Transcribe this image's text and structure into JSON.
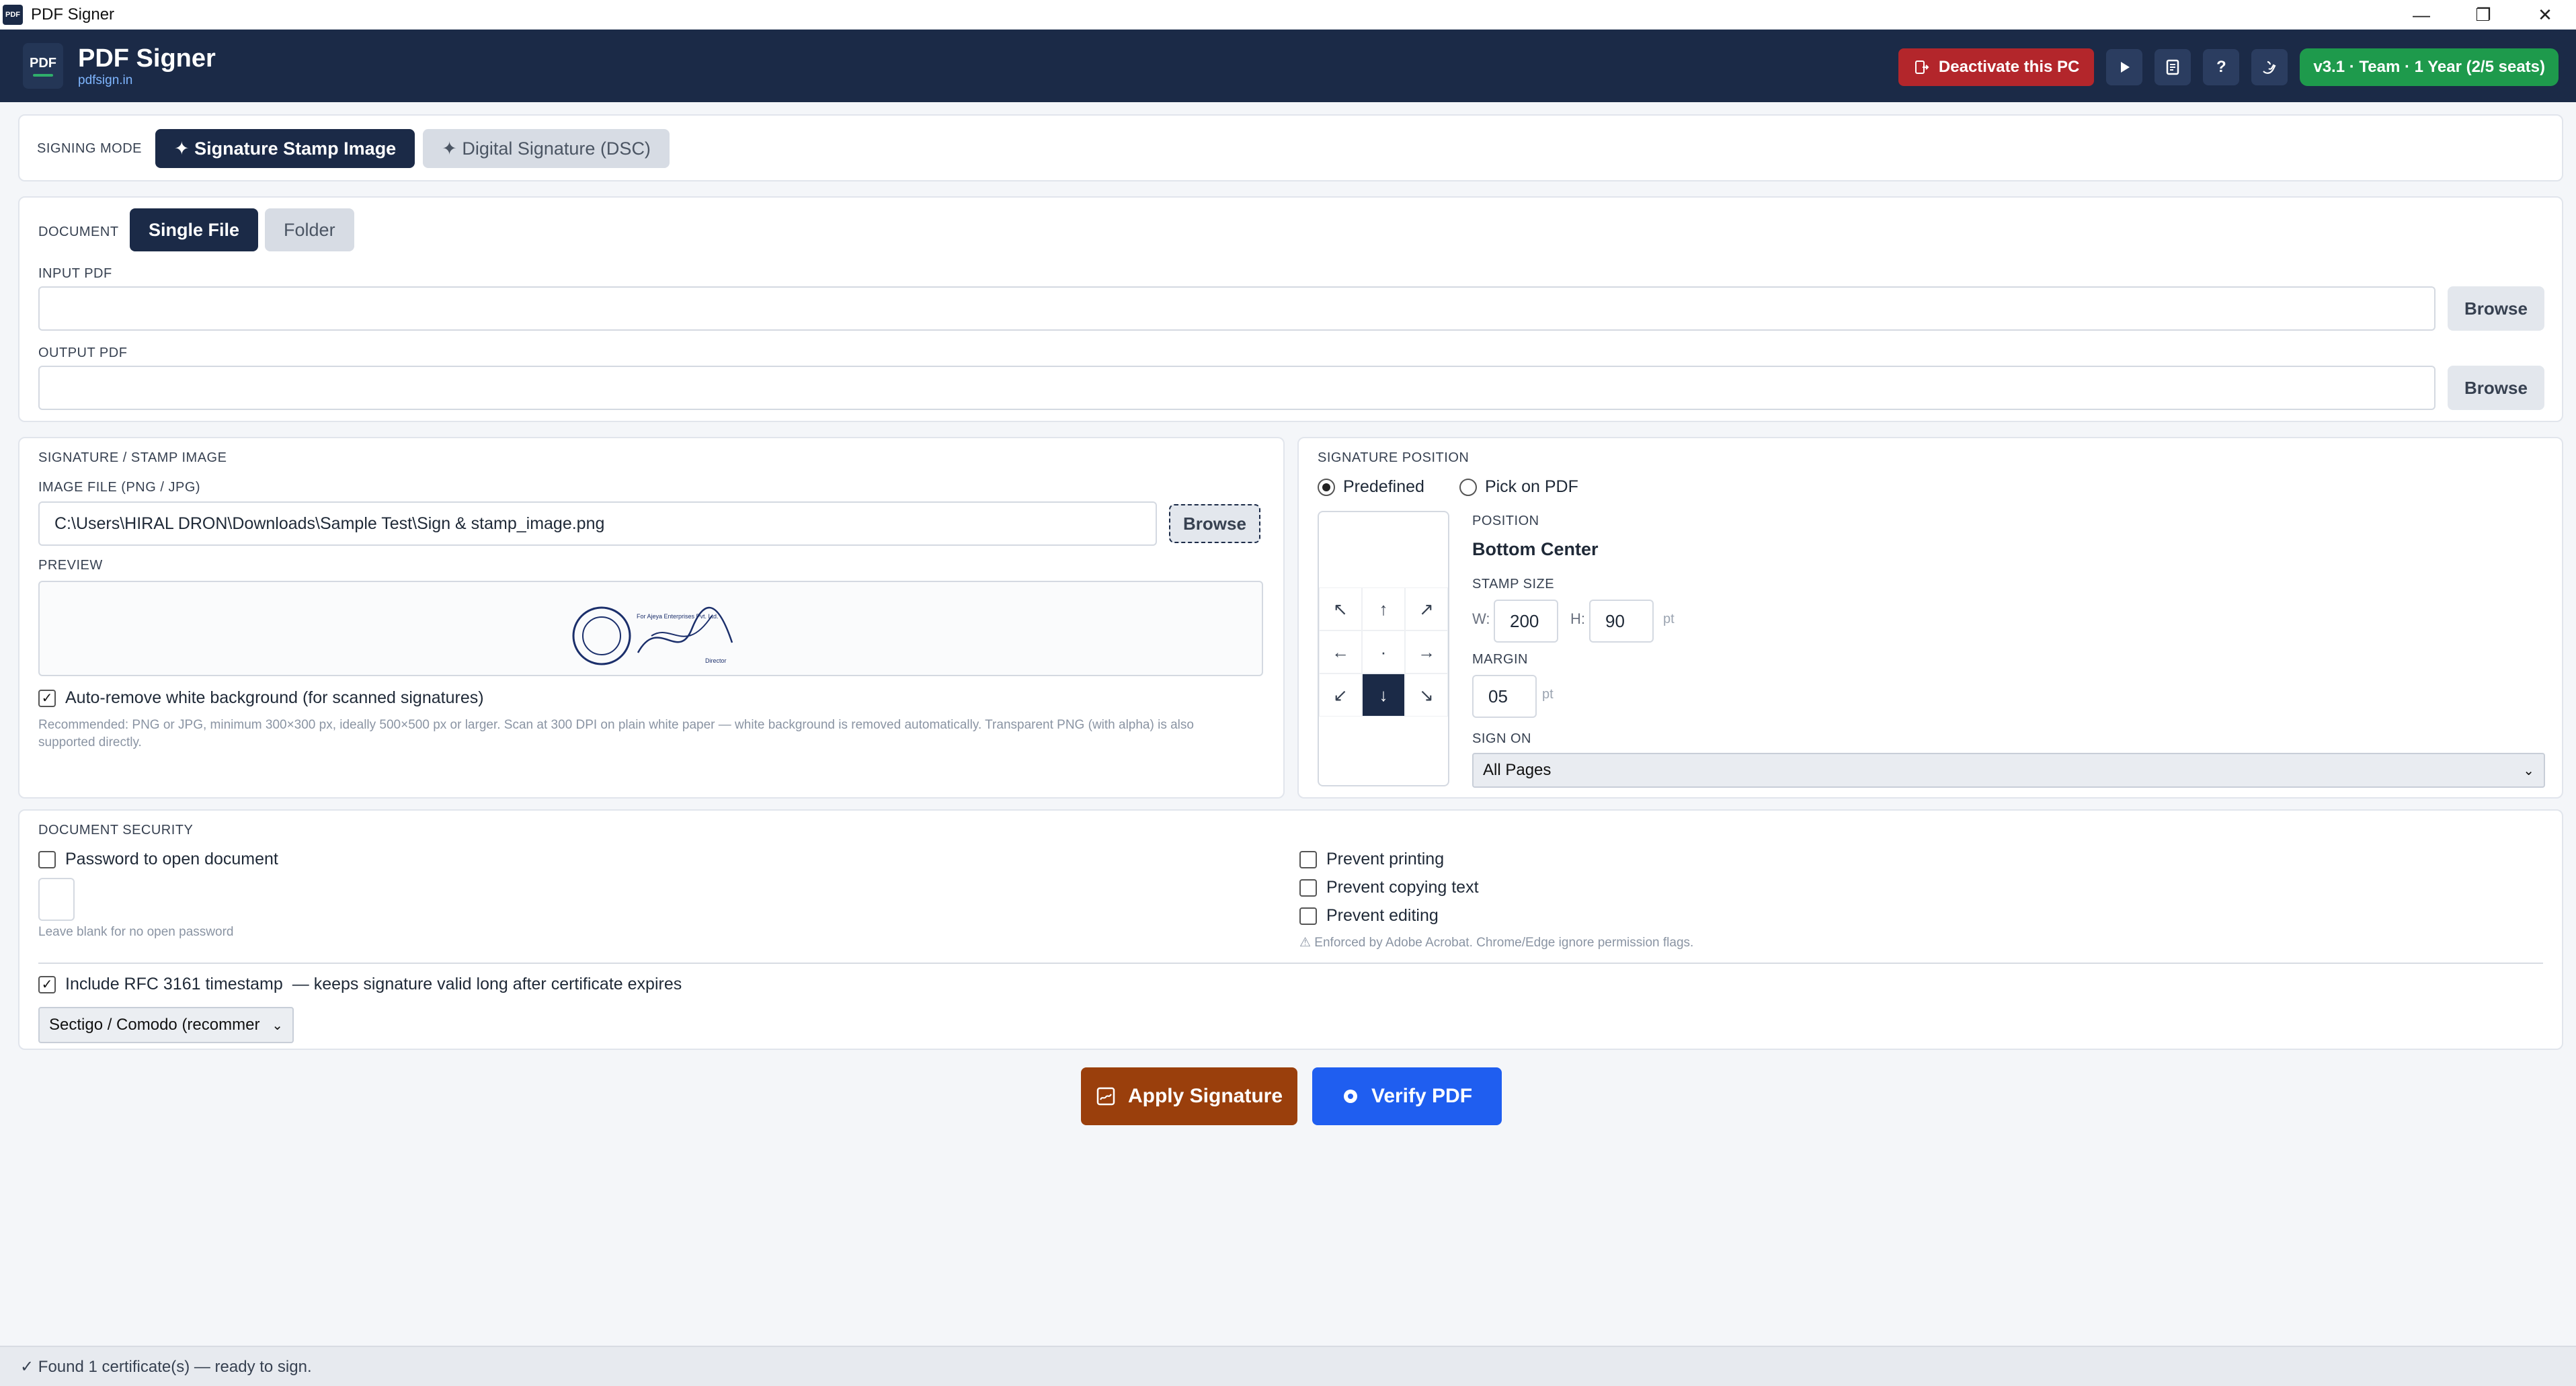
{
  "window": {
    "title": "PDF Signer",
    "app_icon_text": "PDF",
    "controls": {
      "minimize": "—",
      "restore": "❐",
      "close": "✕"
    }
  },
  "header": {
    "logo_text": "PDF",
    "brand_name": "PDF Signer",
    "brand_url": "pdfsign.in",
    "deactivate_label": "Deactivate this PC",
    "icon_buttons": [
      "play-icon",
      "document-icon",
      "help-icon",
      "support-icon"
    ],
    "help_text": "?",
    "license_badge": "v3.1 · Team · 1 Year (2/5 seats)",
    "colors": {
      "header_bg": "#1b2a47",
      "deactivate": "#b3262b",
      "license": "#1e9a4c"
    }
  },
  "signing_mode": {
    "label": "SIGNING MODE",
    "options": [
      "✦ Signature Stamp Image",
      "✦ Digital Signature (DSC)"
    ],
    "selected": "Signature Stamp Image"
  },
  "document": {
    "label": "DOCUMENT",
    "tabs": [
      "Single File",
      "Folder"
    ],
    "selected_tab": "Single File",
    "input_label": "INPUT PDF",
    "input_value": "",
    "output_label": "OUTPUT PDF",
    "output_value": "",
    "browse_label": "Browse"
  },
  "stamp_image": {
    "section_label": "SIGNATURE / STAMP IMAGE",
    "file_label": "IMAGE FILE (PNG / JPG)",
    "file_value": "C:\\Users\\HIRAL DRON\\Downloads\\Sample Test\\Sign & stamp_image.png",
    "browse_label": "Browse",
    "preview_label": "PREVIEW",
    "stamp_text": "For Ajeya Enterprises Pvt. Ltd.",
    "stamp_sub": "Director",
    "auto_remove_label": "Auto-remove white background (for scanned signatures)",
    "auto_remove_checked": true,
    "recommendation": "Recommended: PNG or JPG, minimum 300×300 px, ideally 500×500 px or larger. Scan at 300 DPI on plain white paper — white background is removed automatically. Transparent PNG (with alpha) is also supported directly."
  },
  "position": {
    "section_label": "SIGNATURE POSITION",
    "modes": [
      "Predefined",
      "Pick on PDF"
    ],
    "selected_mode": "Predefined",
    "grid_arrows": [
      "↖",
      "↑",
      "↗",
      "←",
      "·",
      "→",
      "↙",
      "↓",
      "↘"
    ],
    "selected_cell": "Bottom Center",
    "position_label": "POSITION",
    "position_value": "Bottom Center",
    "stamp_size_label": "STAMP SIZE",
    "width_label": "W:",
    "width_value": "200",
    "height_label": "H:",
    "height_value": "90",
    "unit": "pt",
    "margin_label": "MARGIN",
    "margin_value": "05",
    "sign_on_label": "SIGN ON",
    "sign_on_value": "All Pages"
  },
  "security": {
    "section_label": "DOCUMENT SECURITY",
    "password_label": "Password to open document",
    "password_checked": false,
    "password_hint": "Leave blank for no open password",
    "permissions": [
      {
        "label": "Prevent printing",
        "checked": false
      },
      {
        "label": "Prevent copying text",
        "checked": false
      },
      {
        "label": "Prevent editing",
        "checked": false
      }
    ],
    "permissions_note": "⚠ Enforced by Adobe Acrobat. Chrome/Edge ignore permission flags.",
    "timestamp_label": "Include RFC 3161 timestamp",
    "timestamp_note": "—  keeps signature valid long after certificate expires",
    "timestamp_checked": true,
    "tsa_value": "Sectigo / Comodo (recommer"
  },
  "actions": {
    "apply_label": "Apply Signature",
    "verify_label": "Verify PDF",
    "colors": {
      "apply": "#9a3f0c",
      "verify": "#1f5ef0"
    }
  },
  "status": {
    "text": "✓ Found 1 certificate(s) — ready to sign."
  }
}
